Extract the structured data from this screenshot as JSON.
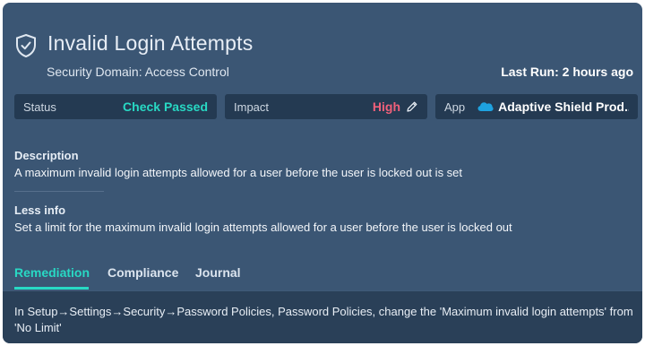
{
  "header": {
    "icon": "shield-check-icon",
    "title": "Invalid Login Attempts",
    "subtitle": "Security Domain: Access Control",
    "last_run": "Last Run: 2 hours ago"
  },
  "cards": {
    "status": {
      "label": "Status",
      "value": "Check Passed",
      "color": "#28d9c4"
    },
    "impact": {
      "label": "Impact",
      "value": "High",
      "color": "#f0607a",
      "icon": "pencil-icon"
    },
    "app": {
      "label": "App",
      "value": "Adaptive Shield Prod...",
      "icon": "salesforce-cloud-icon",
      "icon_color": "#1ea2e0"
    }
  },
  "description": {
    "heading": "Description",
    "text": "A maximum invalid login attempts allowed for a user before the user is locked out is set"
  },
  "less_info": {
    "heading": "Less info",
    "text": "Set a limit for the maximum invalid login attempts allowed for a user before the user is locked out"
  },
  "tabs": [
    {
      "label": "Remediation",
      "active": true
    },
    {
      "label": "Compliance",
      "active": false
    },
    {
      "label": "Journal",
      "active": false
    }
  ],
  "remediation_text": "In Setup→Settings→Security→Password Policies, Password Policies, change the 'Maximum invalid login attempts' from 'No Limit'",
  "colors": {
    "panel_bg": "#3b5674",
    "card_bg": "#243a52",
    "accent": "#28d9c4"
  }
}
